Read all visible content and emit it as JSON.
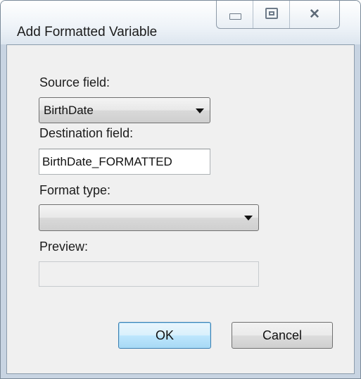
{
  "window": {
    "title": "Add Formatted Variable"
  },
  "form": {
    "source_label": "Source field:",
    "source_value": "BirthDate",
    "destination_label": "Destination field:",
    "destination_value": "BirthDate_FORMATTED",
    "format_label": "Format type:",
    "format_value": "",
    "preview_label": "Preview:",
    "preview_value": ""
  },
  "buttons": {
    "ok": "OK",
    "cancel": "Cancel"
  },
  "icons": [
    "minimize-icon",
    "maximize-icon",
    "close-icon",
    "dropdown-arrow-icon"
  ],
  "colors": {
    "default_button_border": "#3c7fb1",
    "dialog_background": "#f0f0f0"
  }
}
